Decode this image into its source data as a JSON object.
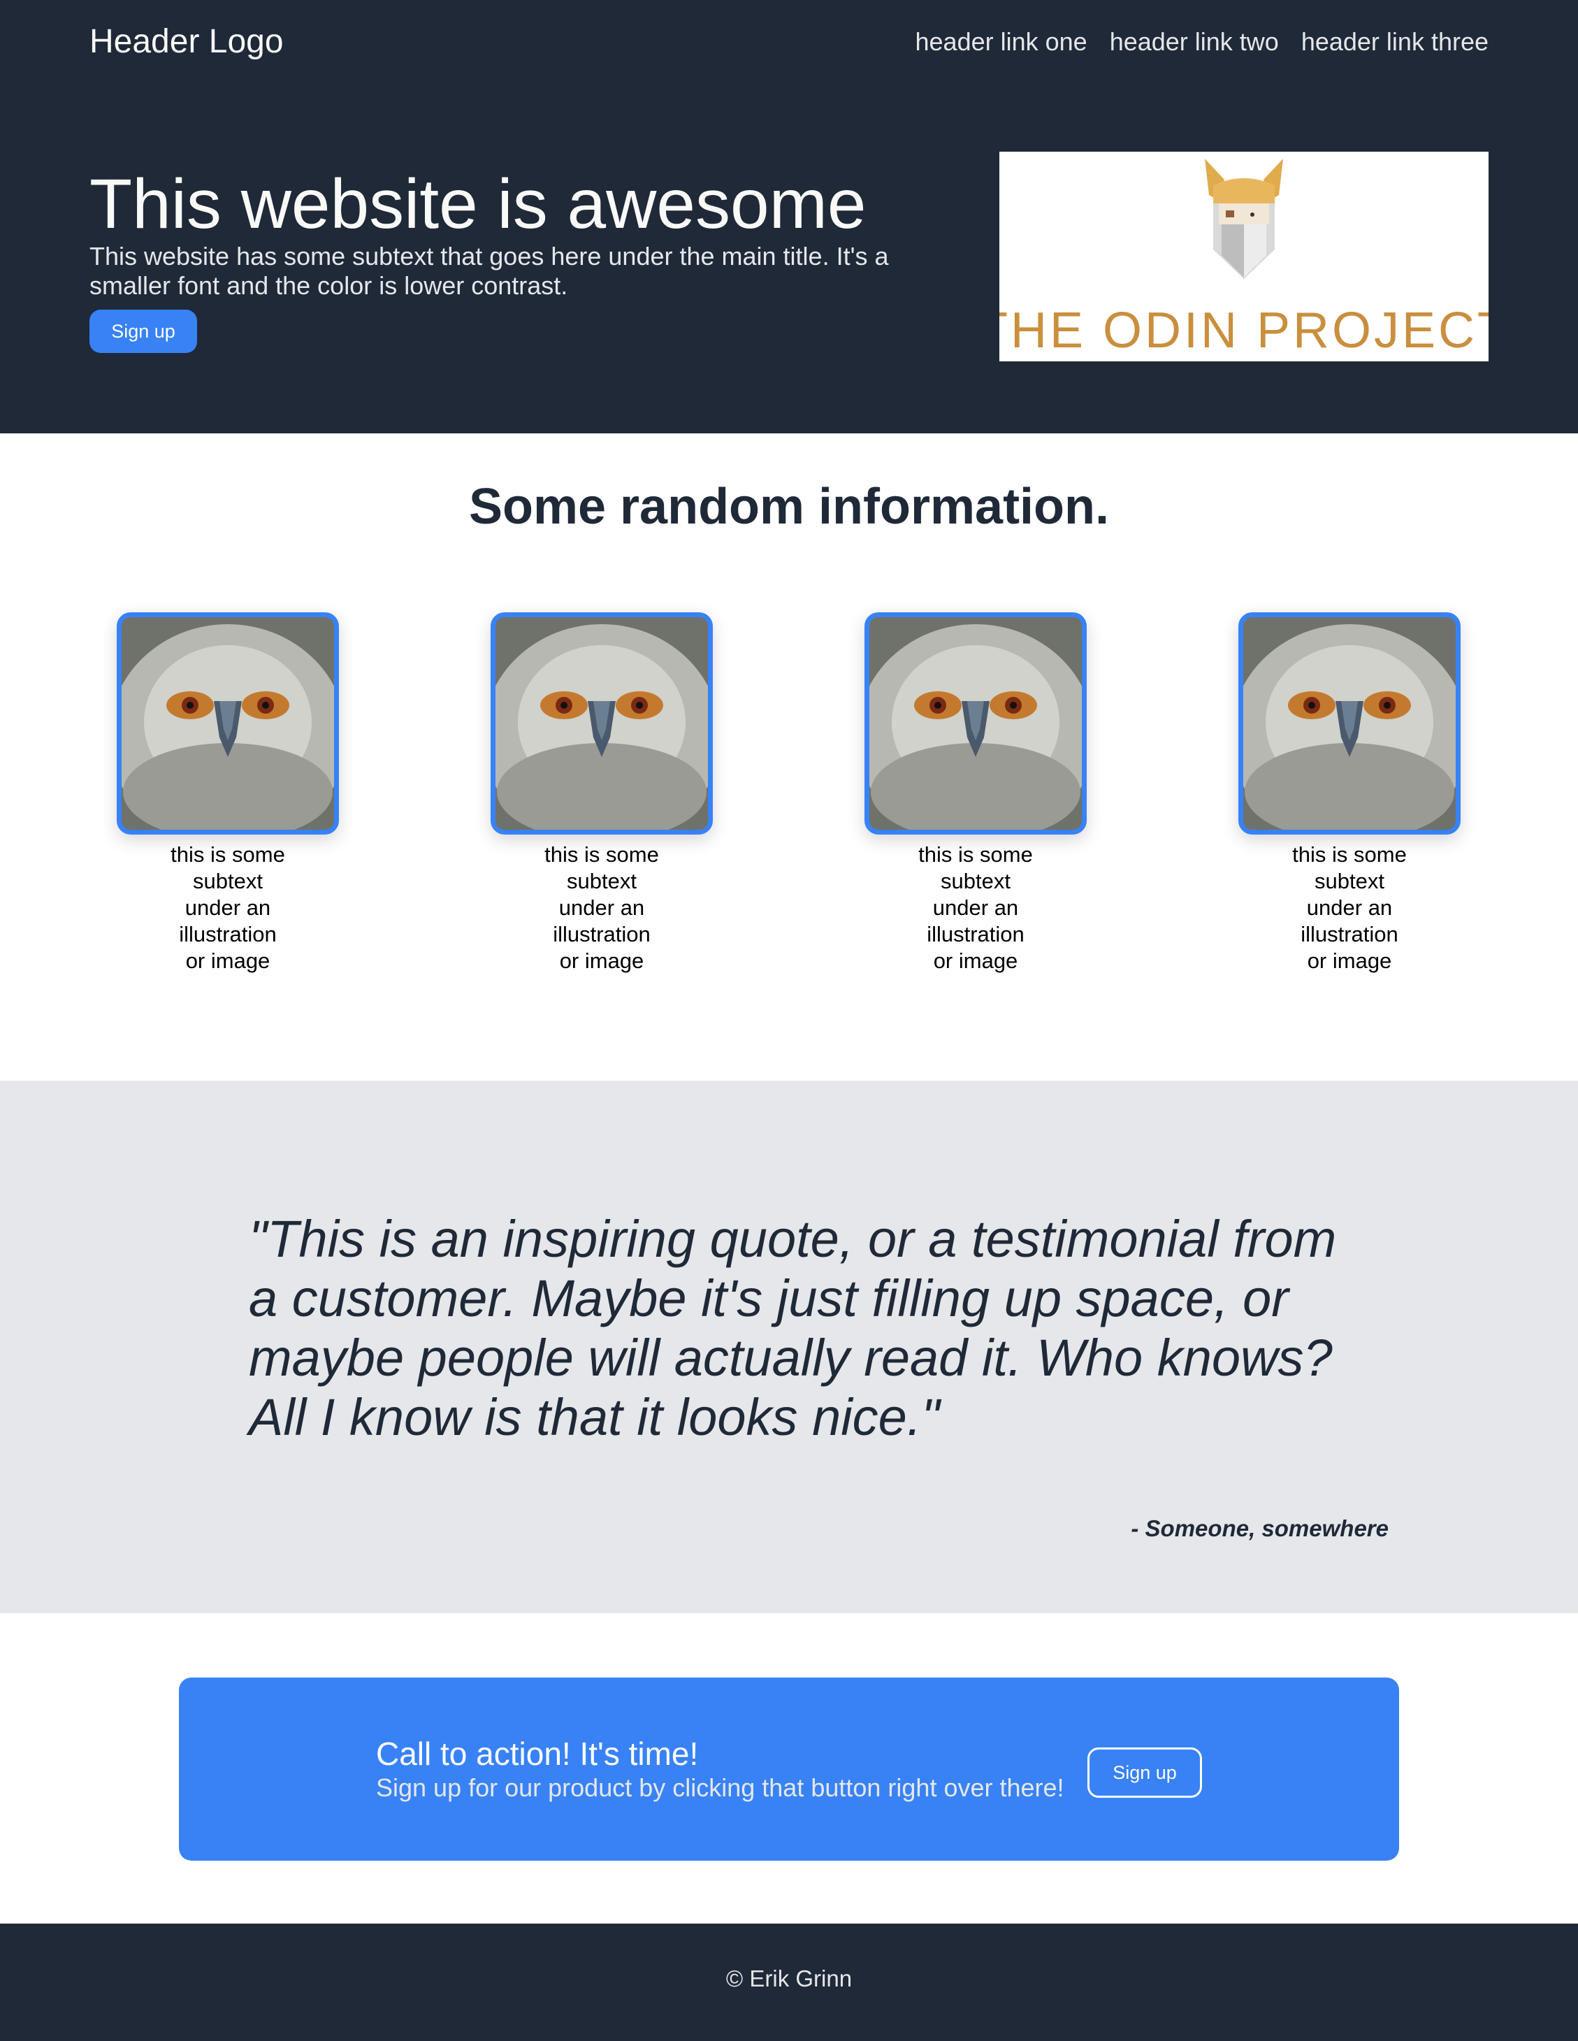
{
  "header": {
    "logo": "Header Logo",
    "links": [
      "header link one",
      "header link two",
      "header link three"
    ]
  },
  "hero": {
    "title": "This website is awesome",
    "subtitle": "This website has some subtext that goes here under the main title. It's a smaller font and the color is lower contrast.",
    "button_label": "Sign up",
    "image_text": "THE ODIN PROJECT"
  },
  "info": {
    "title": "Some random information.",
    "cards": [
      {
        "caption": "this is some subtext under an illustration or image"
      },
      {
        "caption": "this is some subtext under an illustration or image"
      },
      {
        "caption": "this is some subtext under an illustration or image"
      },
      {
        "caption": "this is some subtext under an illustration or image"
      }
    ]
  },
  "quote": {
    "text": "\"This is an inspiring quote, or a testimonial from a customer. Maybe it's just filling up space, or maybe people will actually read it. Who knows? All I know is that it looks nice.\"",
    "author": "- Someone, somewhere"
  },
  "cta": {
    "title": "Call to action! It's time!",
    "subtitle": "Sign up for our product by clicking that button right over there!",
    "button_label": "Sign up"
  },
  "footer": {
    "text": "© Erik Grinn"
  },
  "colors": {
    "dark": "#1f2937",
    "accent": "#3882f6",
    "light_text": "#e5e7eb",
    "quote_bg": "#e5e7eb"
  }
}
